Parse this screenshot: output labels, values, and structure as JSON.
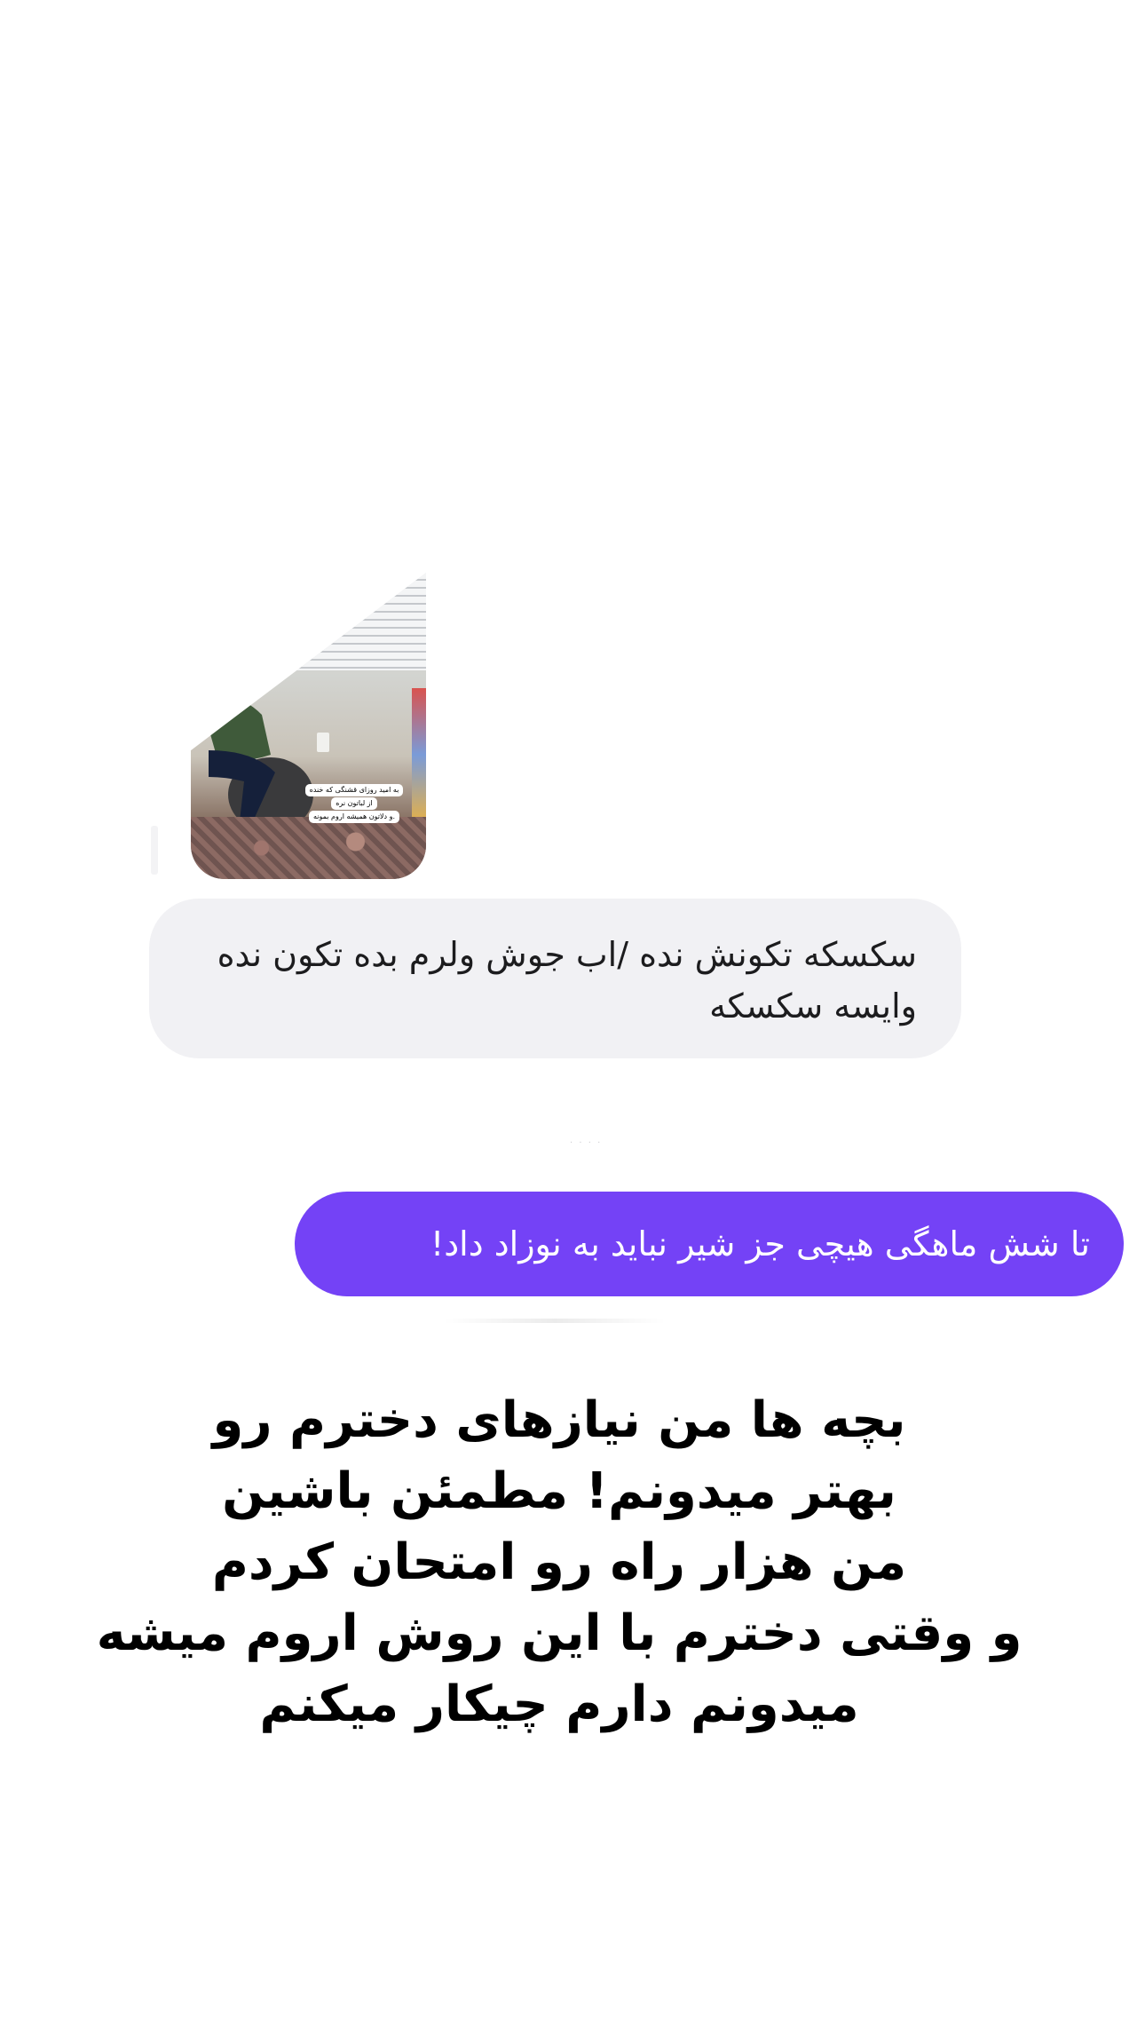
{
  "shared_media": {
    "caption_lines": [
      "به امید روزای قشنگی که خنده",
      "از لباتون نره",
      "و دلاتون همیشه اروم بمونه."
    ]
  },
  "messages": [
    {
      "direction": "received",
      "text": "سکسکه تکونش نده /اب جوش ولرم بده تکون نده وایسه سکسکه"
    },
    {
      "direction": "sent",
      "text": "تا شش ماهگی هیچی جز شیر نباید به نوزاد داد!"
    }
  ],
  "overlay_caption": {
    "lines": [
      "بچه ها من نیازهای دخترم رو",
      "بهتر میدونم! مطمئن باشین",
      "من هزار راه رو امتحان کردم",
      "و وقتی دخترم با این روش اروم میشه",
      "میدونم دارم چیکار میکنم"
    ]
  },
  "colors": {
    "sent_bubble": "#7442f6",
    "received_bubble": "#f1f1f4",
    "background": "#ffffff"
  }
}
